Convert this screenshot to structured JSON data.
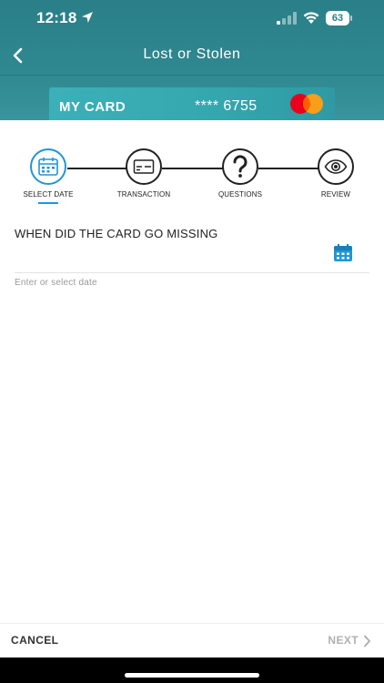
{
  "status_bar": {
    "time": "12:18",
    "battery": "63",
    "icons": [
      "location-arrow-icon",
      "cellular-signal-icon",
      "wifi-icon",
      "battery-icon"
    ]
  },
  "nav": {
    "title": "Lost or Stolen",
    "back_icon": "chevron-left-icon"
  },
  "card": {
    "name": "MY CARD",
    "number": "**** 6755",
    "brand_icon": "mastercard-logo",
    "colors": {
      "accent": "#2f8890",
      "card": "#3cb0b8"
    }
  },
  "stepper": {
    "active_index": 0,
    "active_color": "#2196d3",
    "steps": [
      {
        "label": "SELECT DATE",
        "icon": "calendar-icon"
      },
      {
        "label": "TRANSACTION",
        "icon": "credit-card-icon"
      },
      {
        "label": "QUESTIONS",
        "icon": "question-mark-icon"
      },
      {
        "label": "REVIEW",
        "icon": "eye-icon"
      }
    ]
  },
  "form": {
    "question": "WHEN DID THE CARD GO MISSING",
    "date_value": "",
    "date_placeholder": "Enter or select date",
    "calendar_icon": "calendar-icon"
  },
  "footer": {
    "cancel_label": "CANCEL",
    "next_label": "NEXT",
    "next_icon": "chevron-right-icon"
  }
}
